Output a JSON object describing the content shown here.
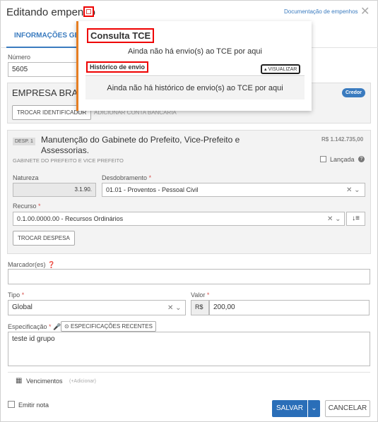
{
  "modal": {
    "title": "Editando empenho",
    "doc_link": "Documentação de empenhos",
    "close": "✕"
  },
  "tabs": [
    {
      "label": "INFORMAÇÕES GER"
    }
  ],
  "numero": {
    "label": "Número",
    "value": "5605"
  },
  "empresa": {
    "name": "EMPRESA BRASI",
    "badge": "Credor",
    "btn_trocar": "TROCAR IDENTIFICADOR",
    "btn_adicionar": "ADICIONAR CONTA BANCÁRIA"
  },
  "despesa": {
    "tag": "DESP. 1",
    "title": "Manutenção do Gabinete do Prefeito, Vice-Prefeito e Assessorias.",
    "subtitle": "GABINETE DO PREFEITO E VICE PREFEITO",
    "amount": "R$ 1.142.735,00",
    "lancada": "Lançada",
    "natureza_label": "Natureza",
    "natureza_value": "3.1.90.",
    "desdobramento_label": "Desdobramento",
    "desdobramento_value": "01.01 - Proventos - Pessoal Civil",
    "recurso_label": "Recurso",
    "recurso_value": "0.1.00.0000.00 - Recursos Ordinários",
    "btn_trocar": "TROCAR DESPESA"
  },
  "marcadores": {
    "label": "Marcador(es)"
  },
  "tipo": {
    "label": "Tipo",
    "value": "Global"
  },
  "valor": {
    "label": "Valor",
    "currency": "R$",
    "value": "200,00"
  },
  "especificacao": {
    "label": "Especificação",
    "btn_recentes": "ESPECIFICAÇÕES RECENTES",
    "value": "teste id grupo"
  },
  "vencimentos": {
    "label": "Vencimentos",
    "add": "(+Adicionar)"
  },
  "footer": {
    "emitir": "Emitir nota",
    "salvar": "SALVAR",
    "cancelar": "CANCELAR"
  },
  "popup": {
    "title": "Consulta TCE",
    "empty_envio": "Ainda não há envio(s) ao TCE por aqui",
    "historico_label": "Histórico de envio",
    "visualizar": "▴ VISUALIZAR",
    "empty_historico": "Ainda não há histórico de envio(s) ao TCE por aqui"
  },
  "colors": {
    "accent": "#3a7bbf",
    "primary": "#2a6eb8",
    "highlight": "#e00000",
    "popup_border": "#e67e22"
  }
}
